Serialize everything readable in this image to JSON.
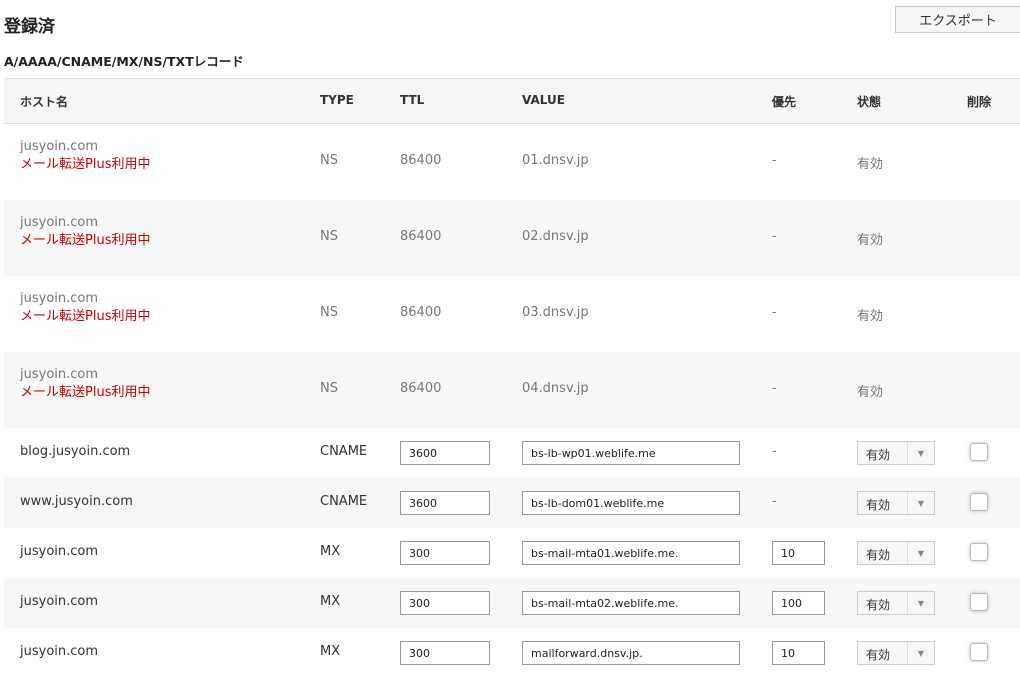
{
  "header": {
    "title": "登録済",
    "export_label": "エクスポート",
    "subtitle": "A/AAAA/CNAME/MX/NS/TXTレコード"
  },
  "columns": {
    "host": "ホスト名",
    "type": "TYPE",
    "ttl": "TTL",
    "value": "VALUE",
    "priority": "優先",
    "status": "状態",
    "delete": "削除"
  },
  "ns_records": [
    {
      "host": "jusyoin.com",
      "note": "メール転送Plus利用中",
      "type": "NS",
      "ttl": "86400",
      "value": "01.dnsv.jp",
      "priority": "-",
      "status": "有効"
    },
    {
      "host": "jusyoin.com",
      "note": "メール転送Plus利用中",
      "type": "NS",
      "ttl": "86400",
      "value": "02.dnsv.jp",
      "priority": "-",
      "status": "有効"
    },
    {
      "host": "jusyoin.com",
      "note": "メール転送Plus利用中",
      "type": "NS",
      "ttl": "86400",
      "value": "03.dnsv.jp",
      "priority": "-",
      "status": "有効"
    },
    {
      "host": "jusyoin.com",
      "note": "メール転送Plus利用中",
      "type": "NS",
      "ttl": "86400",
      "value": "04.dnsv.jp",
      "priority": "-",
      "status": "有効"
    }
  ],
  "edit_records": [
    {
      "host": "blog.jusyoin.com",
      "type": "CNAME",
      "ttl": "3600",
      "value": "bs-lb-wp01.weblife.me",
      "priority": "-",
      "status": "有効"
    },
    {
      "host": "www.jusyoin.com",
      "type": "CNAME",
      "ttl": "3600",
      "value": "bs-lb-dom01.weblife.me",
      "priority": "-",
      "status": "有効"
    },
    {
      "host": "jusyoin.com",
      "type": "MX",
      "ttl": "300",
      "value": "bs-mail-mta01.weblife.me.",
      "priority": "10",
      "status": "有効"
    },
    {
      "host": "jusyoin.com",
      "type": "MX",
      "ttl": "300",
      "value": "bs-mail-mta02.weblife.me.",
      "priority": "100",
      "status": "有効"
    },
    {
      "host": "jusyoin.com",
      "type": "MX",
      "ttl": "300",
      "value": "mailforward.dnsv.jp.",
      "priority": "10",
      "status": "有効"
    }
  ],
  "icons": {
    "dropdown": "caret-down-icon"
  }
}
